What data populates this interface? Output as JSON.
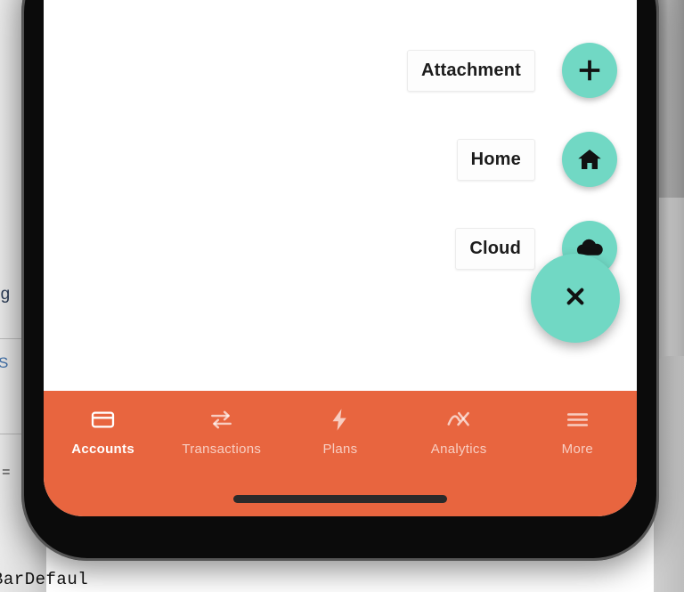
{
  "background": {
    "code_fragment": "BarDefaul",
    "text_fragments": [
      "ng",
      "S"
    ],
    "equals_glyph": "="
  },
  "app": {
    "speed_dial": {
      "expanded": true,
      "actions": [
        {
          "label": "Attachment",
          "icon": "plus-icon"
        },
        {
          "label": "Home",
          "icon": "home-icon"
        },
        {
          "label": "Cloud",
          "icon": "cloud-icon"
        }
      ],
      "main_button": {
        "icon": "close-icon",
        "label": "Close"
      }
    },
    "bottom_nav": {
      "active_index": 0,
      "items": [
        {
          "label": "Accounts",
          "icon": "credit-card-icon"
        },
        {
          "label": "Transactions",
          "icon": "transfer-arrows-icon"
        },
        {
          "label": "Plans",
          "icon": "lightning-bolt-icon"
        },
        {
          "label": "Analytics",
          "icon": "trend-chart-icon"
        },
        {
          "label": "More",
          "icon": "hamburger-menu-icon"
        }
      ]
    }
  },
  "colors": {
    "accent_teal": "#71D8C4",
    "nav_orange": "#E8653F",
    "icon_dark": "#111111",
    "screen_white": "#FFFFFF",
    "home_indicator": "#2A2A2A"
  }
}
